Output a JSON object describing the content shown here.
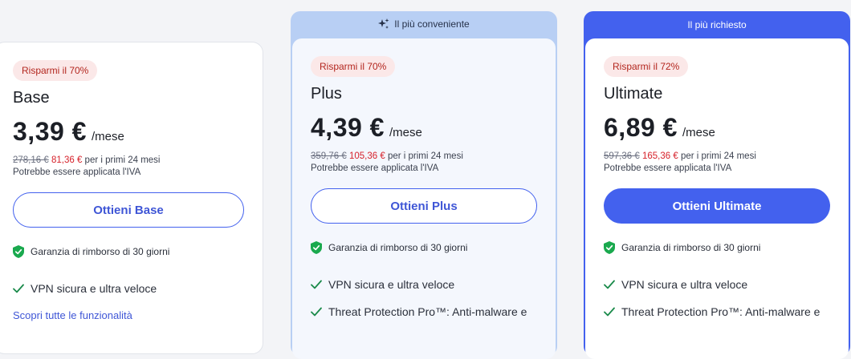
{
  "plans": [
    {
      "id": "base",
      "badge": "Risparmi il 70%",
      "name": "Base",
      "price": "3,39 €",
      "per": "/mese",
      "old_price": "278,16 €",
      "new_price": "81,36 €",
      "period": "per i primi 24 mesi",
      "vat": "Potrebbe essere applicata l'IVA",
      "cta": "Ottieni Base",
      "guarantee": "Garanzia di rimborso di 30 giorni",
      "features": [
        "VPN sicura e ultra veloce"
      ],
      "link": "Scopri tutte le funzionalità"
    },
    {
      "id": "plus",
      "ribbon": "Il più conveniente",
      "badge": "Risparmi il 70%",
      "name": "Plus",
      "price": "4,39 €",
      "per": "/mese",
      "old_price": "359,76 €",
      "new_price": "105,36 €",
      "period": "per i primi 24 mesi",
      "vat": "Potrebbe essere applicata l'IVA",
      "cta": "Ottieni Plus",
      "guarantee": "Garanzia di rimborso di 30 giorni",
      "features": [
        "VPN sicura e ultra veloce",
        "Threat Protection Pro™: Anti-malware e"
      ]
    },
    {
      "id": "ultimate",
      "ribbon": "Il più richiesto",
      "badge": "Risparmi il 72%",
      "name": "Ultimate",
      "price": "6,89 €",
      "per": "/mese",
      "old_price": "597,36 €",
      "new_price": "165,36 €",
      "period": "per i primi 24 mesi",
      "vat": "Potrebbe essere applicata l'IVA",
      "cta": "Ottieni Ultimate",
      "guarantee": "Garanzia di rimborso di 30 giorni",
      "features": [
        "VPN sicura e ultra veloce",
        "Threat Protection Pro™: Anti-malware e"
      ]
    }
  ],
  "icons": {
    "ribbon_plus": "sparkle-icon",
    "guarantee": "shield-check-icon",
    "feature": "checkmark-icon"
  },
  "colors": {
    "accent": "#4361ee",
    "badge_bg": "#fbe8e8",
    "badge_text": "#b3261e",
    "discount_red": "#d6212a",
    "shield_green": "#1aa94e",
    "check_green": "#1a8a4a",
    "plus_ribbon": "#b8cff4"
  }
}
